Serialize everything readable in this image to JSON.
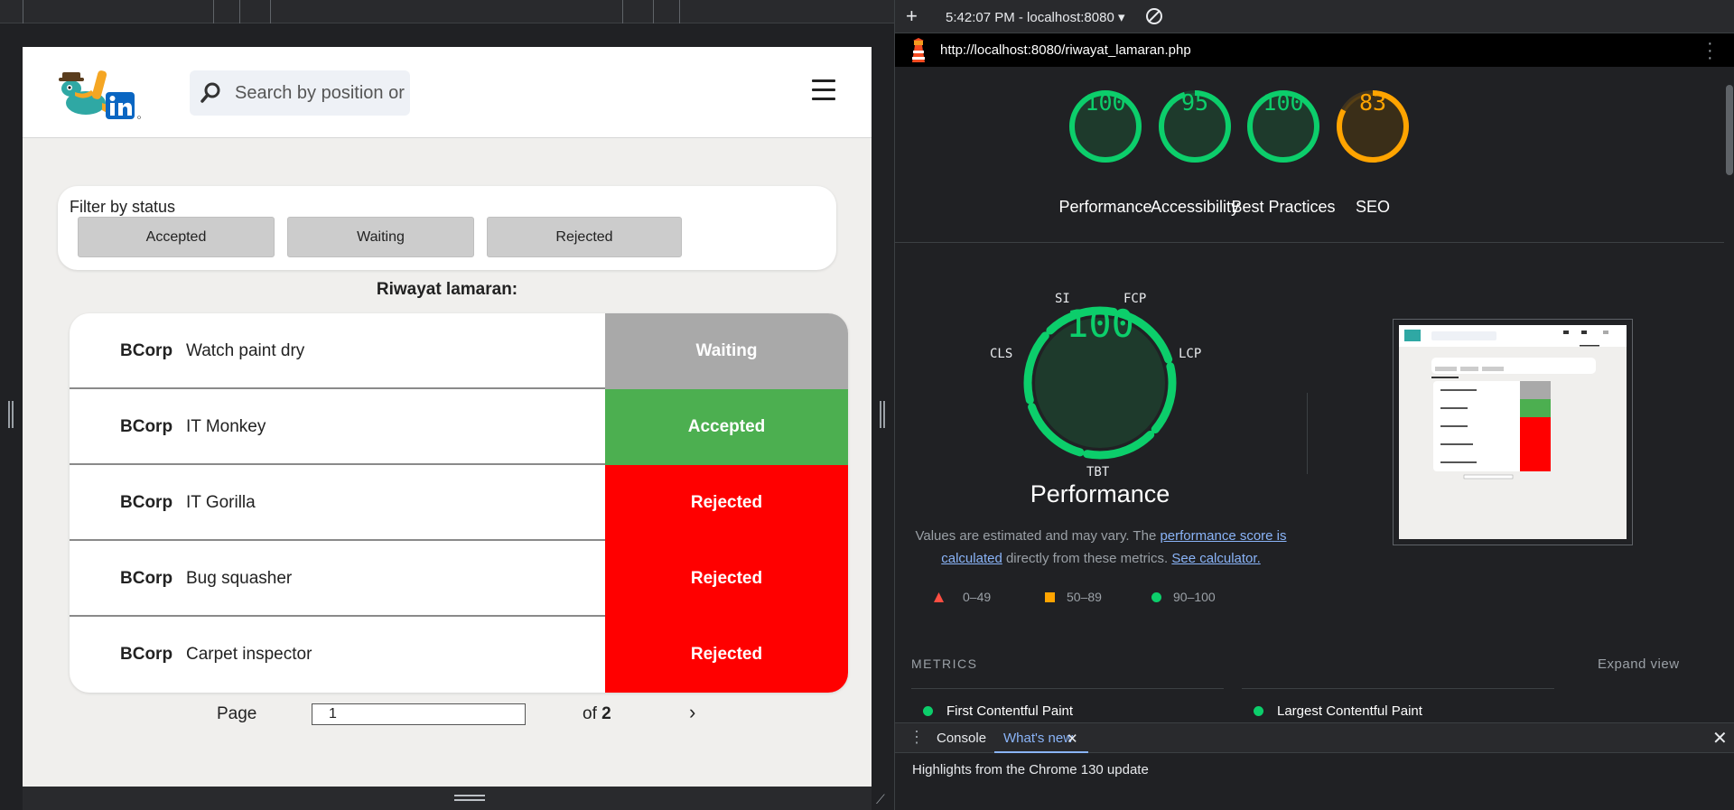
{
  "site": {
    "search_placeholder": "Search by position or company",
    "filter": {
      "label": "Filter by status",
      "buttons": [
        "Accepted",
        "Waiting",
        "Rejected"
      ]
    },
    "history_title": "Riwayat lamaran:",
    "applications": [
      {
        "company": "BCorp",
        "position": "Watch paint dry",
        "status": "Waiting",
        "status_color": "#a9a9a9"
      },
      {
        "company": "BCorp",
        "position": "IT Monkey",
        "status": "Accepted",
        "status_color": "#4caf50"
      },
      {
        "company": "BCorp",
        "position": "IT Gorilla",
        "status": "Rejected",
        "status_color": "#ff0000"
      },
      {
        "company": "BCorp",
        "position": "Bug squasher",
        "status": "Rejected",
        "status_color": "#ff0000"
      },
      {
        "company": "BCorp",
        "position": "Carpet inspector",
        "status": "Rejected",
        "status_color": "#ff0000"
      }
    ],
    "pagination": {
      "label": "Page",
      "current": "1",
      "of_label": "of",
      "total": "2",
      "next_icon": "›"
    }
  },
  "devtools": {
    "session": "5:42:07 PM - localhost:8080 ▾",
    "url": "http://localhost:8080/riwayat_lamaran.php",
    "scores": [
      {
        "label": "Performance",
        "value": 100,
        "color": "#0cce6b"
      },
      {
        "label": "Accessibility",
        "value": 95,
        "color": "#0cce6b"
      },
      {
        "label": "Best Practices",
        "value": 100,
        "color": "#0cce6b"
      },
      {
        "label": "SEO",
        "value": 83,
        "color": "#ffa400"
      }
    ],
    "performance": {
      "score": "100",
      "title": "Performance",
      "metric_labels": {
        "si": "SI",
        "fcp": "FCP",
        "cls": "CLS",
        "lcp": "LCP",
        "tbt": "TBT"
      },
      "desc_prefix": "Values are estimated and may vary. The ",
      "desc_link1": "performance score is calculated",
      "desc_middle": " directly from these metrics. ",
      "desc_link2": "See calculator.",
      "legend": [
        {
          "range": "0–49",
          "shape": "triangle",
          "color": "#ff4e42"
        },
        {
          "range": "50–89",
          "shape": "square",
          "color": "#ffa400"
        },
        {
          "range": "90–100",
          "shape": "circle",
          "color": "#0cce6b"
        }
      ]
    },
    "metrics": {
      "section_label": "METRICS",
      "expand_label": "Expand view",
      "items": [
        "First Contentful Paint",
        "Largest Contentful Paint"
      ]
    },
    "drawer": {
      "tabs": [
        "Console",
        "What's new"
      ],
      "text": "Highlights from the Chrome 130 update"
    }
  }
}
